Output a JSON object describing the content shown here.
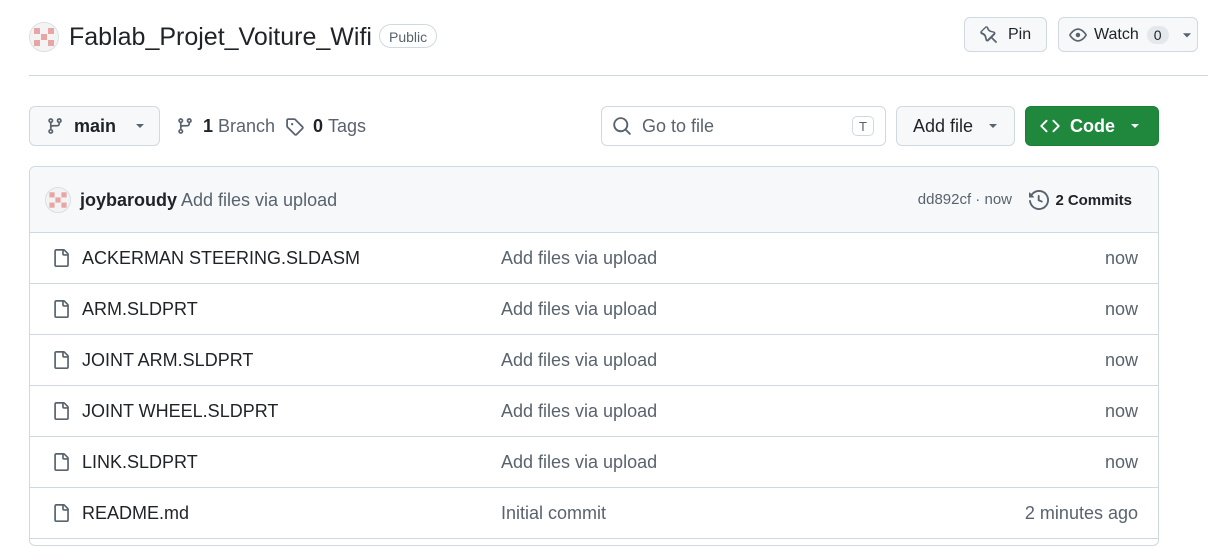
{
  "repo": {
    "name": "Fablab_Projet_Voiture_Wifi",
    "visibility": "Public"
  },
  "header_actions": {
    "pin_label": "Pin",
    "watch_label": "Watch",
    "watch_count": "0"
  },
  "toolbar": {
    "branch": "main",
    "branch_count": "1",
    "branch_label": "Branch",
    "tag_count": "0",
    "tag_label": "Tags",
    "search_placeholder": "Go to file",
    "search_shortcut": "T",
    "add_file_label": "Add file",
    "code_label": "Code"
  },
  "latest_commit": {
    "author": "joybaroudy",
    "message": "Add files via upload",
    "hash_time": "dd892cf · now",
    "commits_count": "2",
    "commits_label": "Commits"
  },
  "files": [
    {
      "name": "ACKERMAN STEERING.SLDASM",
      "message": "Add files via upload",
      "time": "now"
    },
    {
      "name": "ARM.SLDPRT",
      "message": "Add files via upload",
      "time": "now"
    },
    {
      "name": "JOINT ARM.SLDPRT",
      "message": "Add files via upload",
      "time": "now"
    },
    {
      "name": "JOINT WHEEL.SLDPRT",
      "message": "Add files via upload",
      "time": "now"
    },
    {
      "name": "LINK.SLDPRT",
      "message": "Add files via upload",
      "time": "now"
    },
    {
      "name": "README.md",
      "message": "Initial commit",
      "time": "2 minutes ago"
    }
  ],
  "colors": {
    "accent_green": "#1f883d",
    "border": "#d1d9e0",
    "muted_text": "#59636e",
    "avatar_pink": "#e8a5a5"
  }
}
